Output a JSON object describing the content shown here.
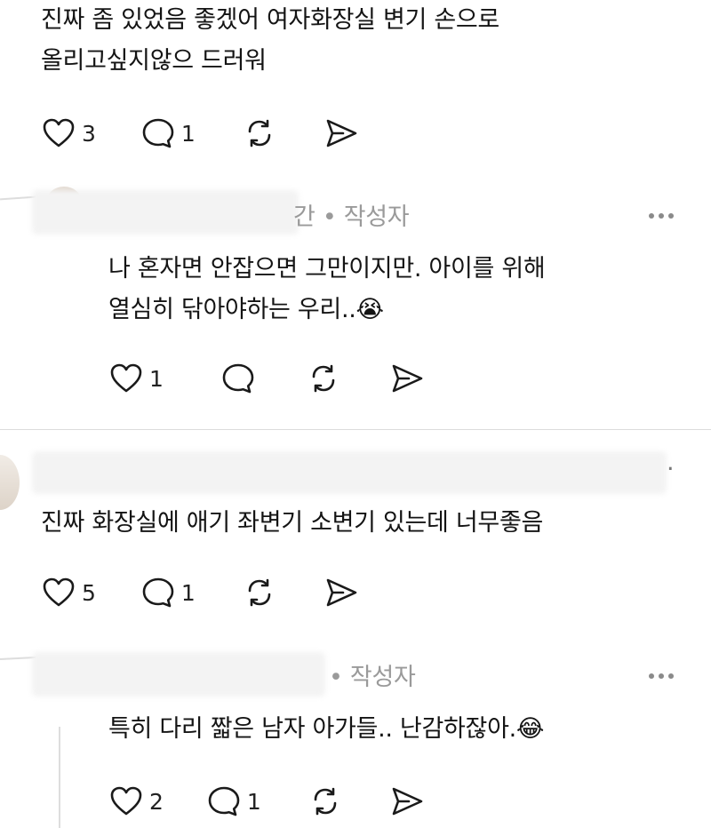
{
  "comments": [
    {
      "text_lines": [
        "진짜 좀 있었음 좋겠어 여자화장실 변기 손으로",
        "올리고싶지않으  드러워"
      ],
      "likes": "3",
      "replies": "1"
    },
    {
      "meta": "간 • 작성자",
      "text_lines": [
        "나 혼자면 안잡으면 그만이지만. 아이를 위해",
        "열심히 닦아야하는 우리..😭"
      ],
      "likes": "1",
      "replies": ""
    },
    {
      "meta": ".",
      "text_lines": [
        "진짜 화장실에 애기 좌변기 소변기 있는데 너무좋음"
      ],
      "likes": "5",
      "replies": "1"
    },
    {
      "meta": "• 작성자",
      "text_lines": [
        "특히 다리 짧은 남자 아가들.. 난감하잖아.😂"
      ],
      "likes": "2",
      "replies": "1"
    }
  ],
  "colors": {
    "text": "#141414",
    "meta": "#9a9a9a",
    "icon": "#1a1a1a",
    "divider": "#dcdcdc"
  }
}
